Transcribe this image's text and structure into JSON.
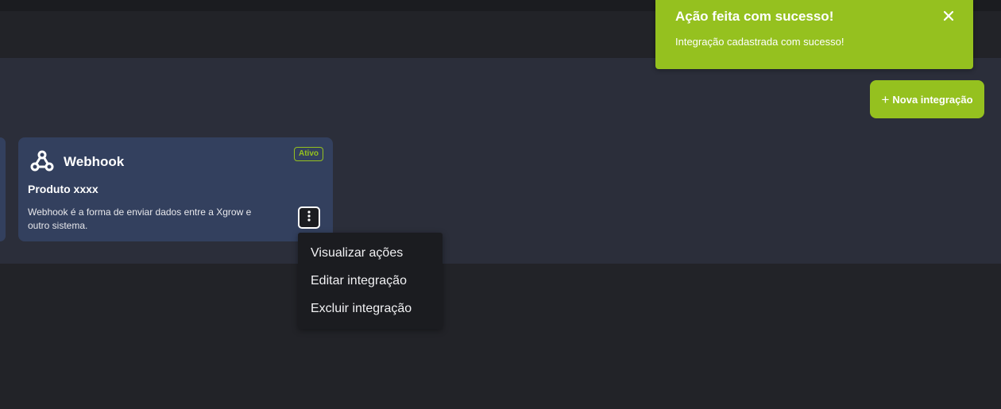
{
  "toast": {
    "title": "Ação feita com sucesso!",
    "message": "Integração cadastrada com sucesso!",
    "close_icon": "close-icon",
    "color": "#95c11f"
  },
  "actions": {
    "new_integration_label": "Nova integração",
    "plus_icon": "plus-icon"
  },
  "card": {
    "icon": "webhook-icon",
    "title": "Webhook",
    "status_badge": "Ativo",
    "product": "Produto xxxx",
    "description": "Webhook é a forma de enviar dados entre a Xgrow e outro sistema.",
    "menu_icon": "kebab-menu-icon"
  },
  "dropdown": {
    "items": [
      {
        "label": "Visualizar ações"
      },
      {
        "label": "Editar integração"
      },
      {
        "label": "Excluir integração"
      }
    ]
  },
  "colors": {
    "accent": "#95c11f",
    "background": "#222328",
    "panel": "#2b2e3a",
    "card": "#33405e",
    "menu": "#1b1c20"
  }
}
